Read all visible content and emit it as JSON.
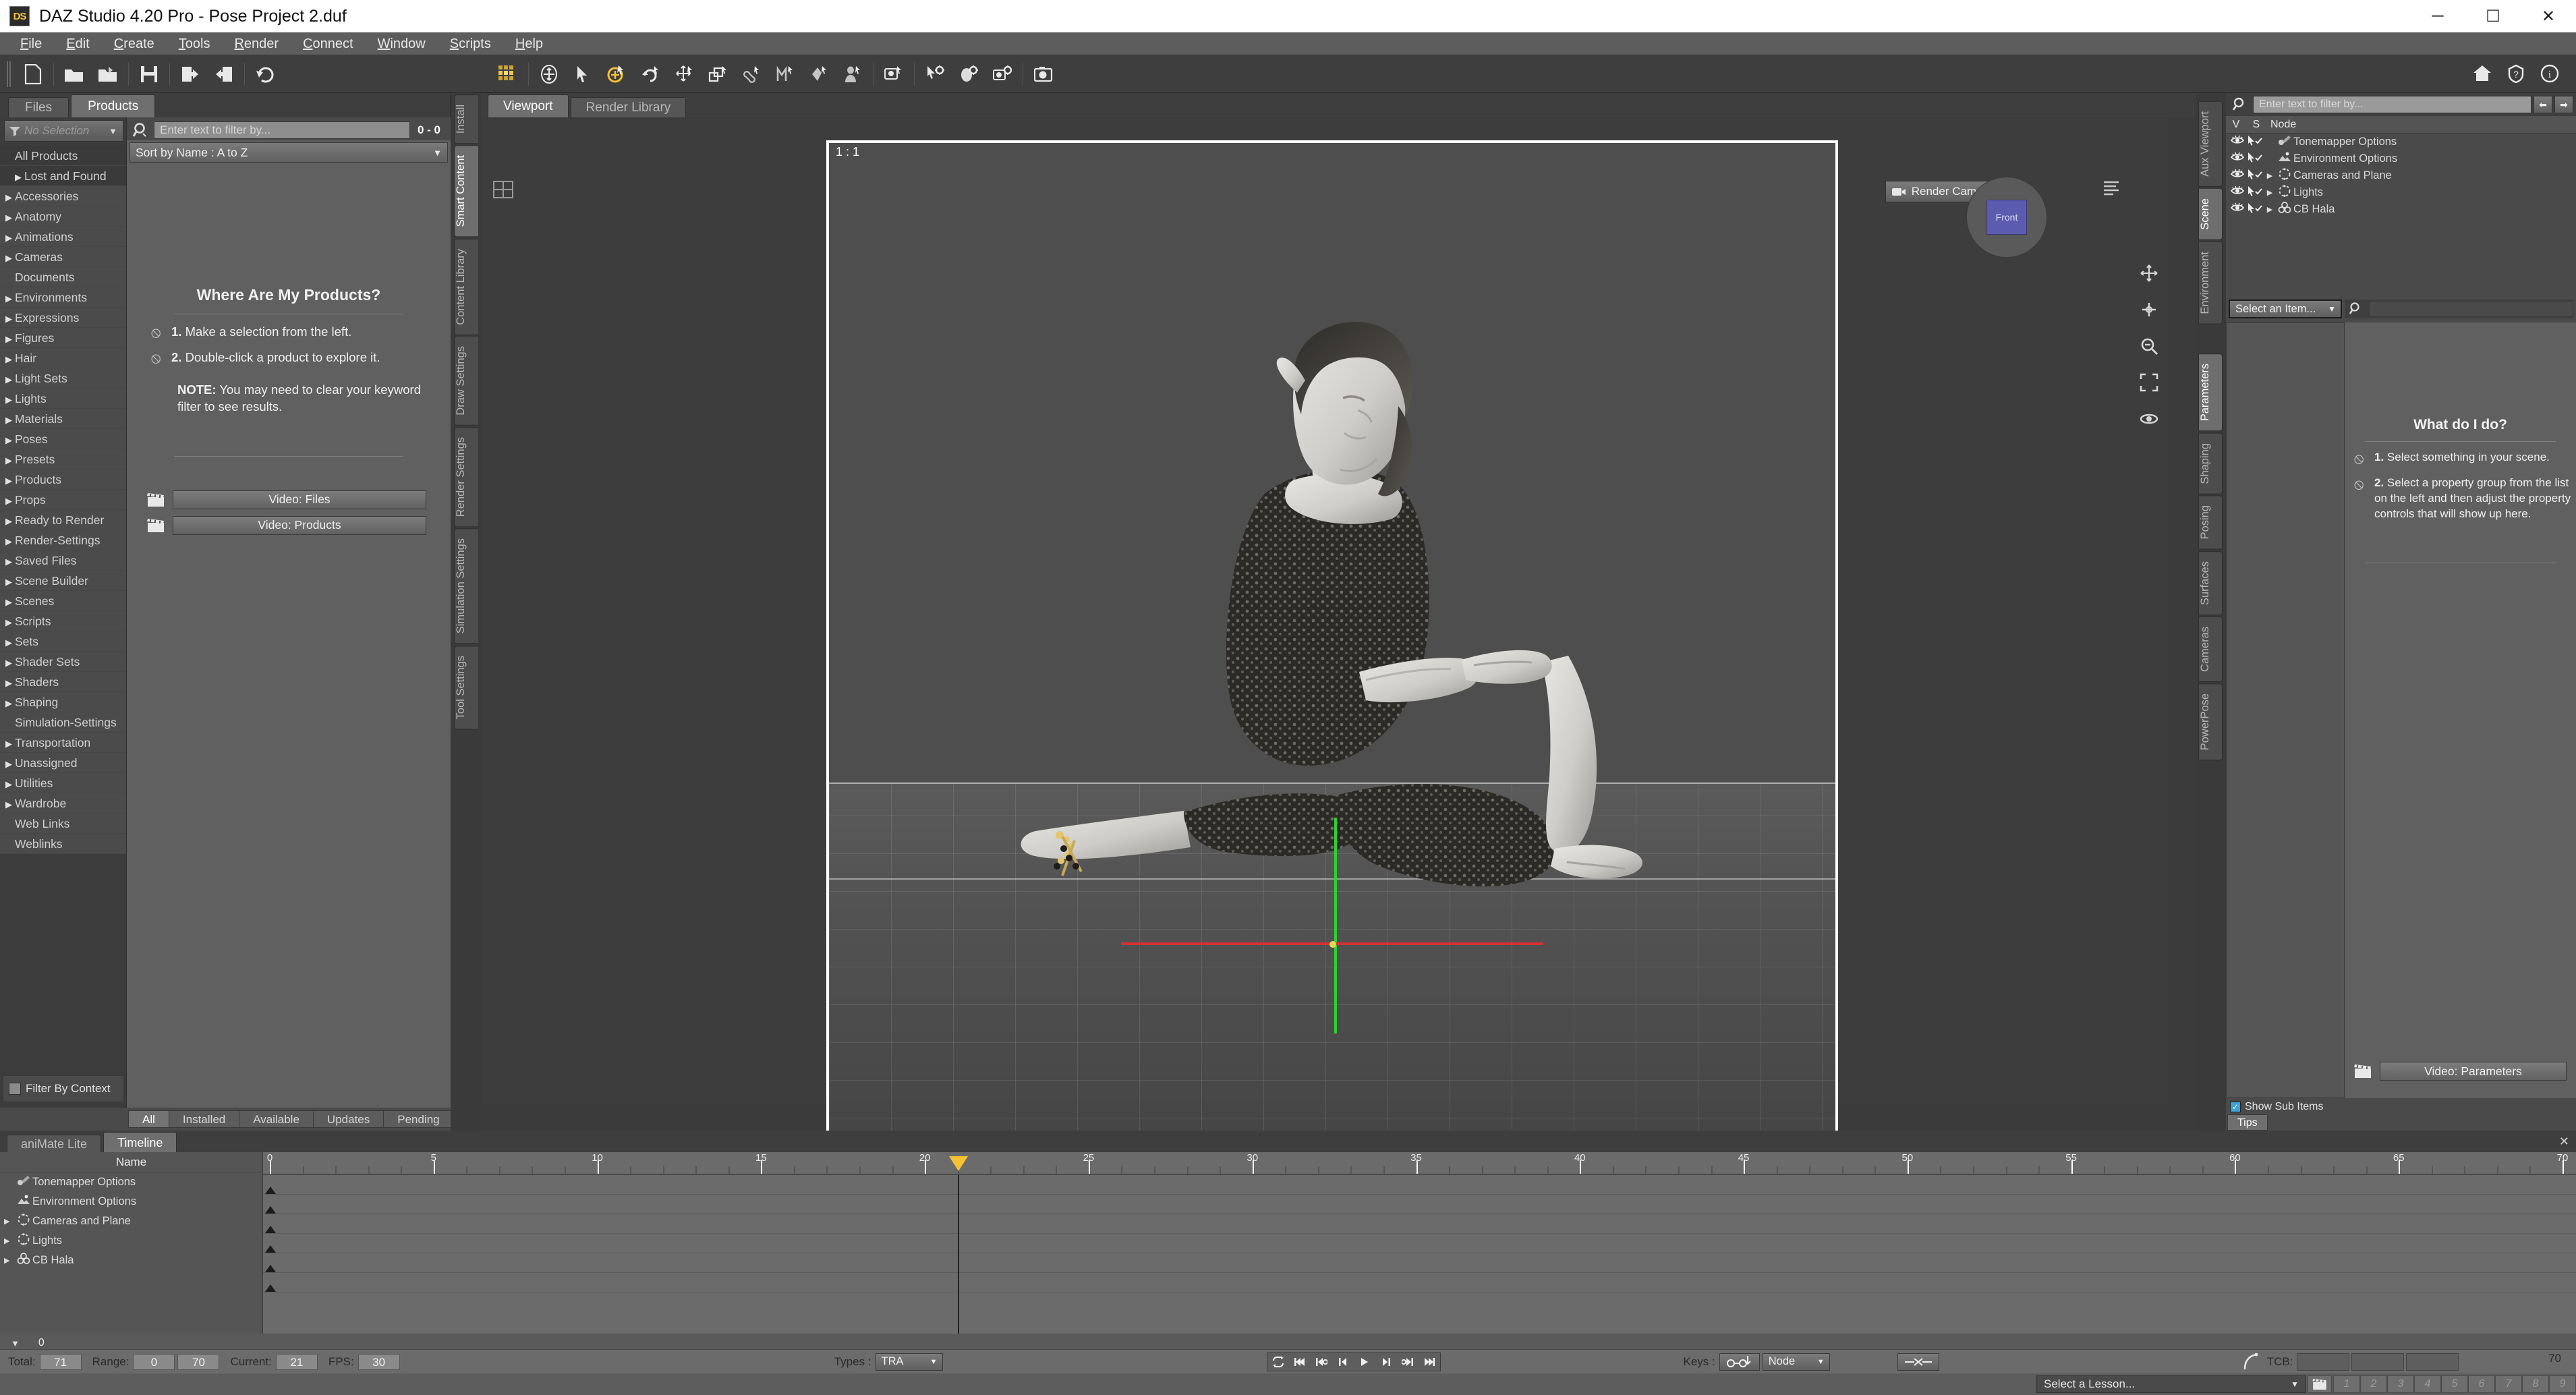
{
  "window": {
    "title": "DAZ Studio 4.20 Pro - Pose Project 2.duf",
    "logo": "DS",
    "minimize": "─",
    "maximize": "☐",
    "close": "✕"
  },
  "menu": [
    "File",
    "Edit",
    "Create",
    "Tools",
    "Render",
    "Connect",
    "Window",
    "Scripts",
    "Help"
  ],
  "toolbar": {
    "left_icons": [
      "new-document-icon",
      "open-folder-icon",
      "open-recent-icon",
      "save-icon",
      "import-icon",
      "export-icon",
      "undo-icon"
    ],
    "center_icons": [
      "texture-shaded-icon",
      "universal-manipulator-icon",
      "node-select-icon",
      "active-pose-icon",
      "rotate-icon",
      "translate-icon",
      "scale-icon",
      "bone-edit-icon",
      "morph-tool-icon",
      "mesh-grabber-icon",
      "surface-select-icon",
      "spot-render-icon",
      "node-pose-icon",
      "render-settings-icon",
      "camera-settings-icon",
      "render-icon"
    ],
    "right_icons": [
      "home-icon",
      "help-question-icon",
      "info-icon"
    ]
  },
  "left_panel": {
    "tabs": [
      {
        "label": "Files",
        "active": false
      },
      {
        "label": "Products",
        "active": true
      }
    ],
    "selection_dropdown": "No Selection",
    "categories": [
      {
        "label": "All Products",
        "expandable": false,
        "highlight": true
      },
      {
        "label": "Lost and Found",
        "expandable": true,
        "highlight": true
      },
      {
        "label": "Accessories",
        "expandable": true
      },
      {
        "label": "Anatomy",
        "expandable": true
      },
      {
        "label": "Animations",
        "expandable": true
      },
      {
        "label": "Cameras",
        "expandable": true
      },
      {
        "label": "Documents",
        "expandable": false
      },
      {
        "label": "Environments",
        "expandable": true
      },
      {
        "label": "Expressions",
        "expandable": true
      },
      {
        "label": "Figures",
        "expandable": true
      },
      {
        "label": "Hair",
        "expandable": true
      },
      {
        "label": "Light Sets",
        "expandable": true
      },
      {
        "label": "Lights",
        "expandable": true
      },
      {
        "label": "Materials",
        "expandable": true
      },
      {
        "label": "Poses",
        "expandable": true
      },
      {
        "label": "Presets",
        "expandable": true
      },
      {
        "label": "Products",
        "expandable": true
      },
      {
        "label": "Props",
        "expandable": true
      },
      {
        "label": "Ready to Render",
        "expandable": true
      },
      {
        "label": "Render-Settings",
        "expandable": true
      },
      {
        "label": "Saved Files",
        "expandable": true
      },
      {
        "label": "Scene Builder",
        "expandable": true
      },
      {
        "label": "Scenes",
        "expandable": true
      },
      {
        "label": "Scripts",
        "expandable": true
      },
      {
        "label": "Sets",
        "expandable": true
      },
      {
        "label": "Shader Sets",
        "expandable": true
      },
      {
        "label": "Shaders",
        "expandable": true
      },
      {
        "label": "Shaping",
        "expandable": true
      },
      {
        "label": "Simulation-Settings",
        "expandable": false
      },
      {
        "label": "Transportation",
        "expandable": true
      },
      {
        "label": "Unassigned",
        "expandable": true
      },
      {
        "label": "Utilities",
        "expandable": true
      },
      {
        "label": "Wardrobe",
        "expandable": true
      },
      {
        "label": "Web Links",
        "expandable": false
      },
      {
        "label": "Weblinks",
        "expandable": false
      }
    ],
    "filter_by_context": "Filter By Context",
    "search_placeholder": "Enter text to filter by...",
    "result_count": "0 - 0",
    "sort": "Sort by Name : A to Z",
    "help": {
      "title": "Where Are My Products?",
      "step1_num": "1.",
      "step1": "Make a selection from the left.",
      "step2_num": "2.",
      "step2": "Double-click a product to explore it.",
      "note_label": "NOTE:",
      "note": "You may need to clear your keyword filter to see results.",
      "video_files": "Video: Files",
      "video_products": "Video: Products"
    },
    "install_tabs": [
      {
        "label": "All",
        "active": true
      },
      {
        "label": "Installed",
        "active": false
      },
      {
        "label": "Available",
        "active": false
      },
      {
        "label": "Updates",
        "active": false
      },
      {
        "label": "Pending",
        "active": false
      }
    ],
    "vtabs": [
      {
        "label": "Install",
        "active": false
      },
      {
        "label": "Smart Content",
        "active": true
      },
      {
        "label": "Content Library",
        "active": false
      },
      {
        "label": "Draw Settings",
        "active": false
      },
      {
        "label": "Render Settings",
        "active": false
      },
      {
        "label": "Simulation Settings",
        "active": false
      },
      {
        "label": "Tool Settings",
        "active": false
      }
    ]
  },
  "viewport": {
    "tabs": [
      {
        "label": "Viewport",
        "active": true
      },
      {
        "label": "Render Library",
        "active": false
      }
    ],
    "aspect_ratio": "1 : 1",
    "camera": "Render Cam",
    "nav_cube_label": "Front",
    "right_tools": [
      "pan-icon",
      "move-icon",
      "zoom-icon",
      "frame-icon",
      "orbit-icon"
    ]
  },
  "right_panel": {
    "vtabs_top": [
      {
        "label": "Aux Viewport",
        "active": false
      },
      {
        "label": "Scene",
        "active": true
      },
      {
        "label": "Environment",
        "active": false
      }
    ],
    "vtabs_bottom": [
      {
        "label": "Parameters",
        "active": true
      },
      {
        "label": "Shaping",
        "active": false
      },
      {
        "label": "Posing",
        "active": false
      },
      {
        "label": "Surfaces",
        "active": false
      },
      {
        "label": "Cameras",
        "active": false
      },
      {
        "label": "PowerPose",
        "active": false
      }
    ],
    "search_placeholder": "Enter text to filter by...",
    "node_headers": [
      "V",
      "S",
      "Node"
    ],
    "nodes": [
      {
        "label": "Tonemapper Options",
        "icon": "tonemapper-icon",
        "expandable": false
      },
      {
        "label": "Environment Options",
        "icon": "environment-icon",
        "expandable": false
      },
      {
        "label": "Cameras and Plane",
        "icon": "group-icon",
        "expandable": true
      },
      {
        "label": "Lights",
        "icon": "group-icon",
        "expandable": true
      },
      {
        "label": "CB Hala",
        "icon": "figure-icon",
        "expandable": true
      }
    ],
    "select_item": "Select an Item...",
    "help": {
      "title": "What do I do?",
      "step1_num": "1.",
      "step1": "Select something in your scene.",
      "step2_num": "2.",
      "step2": "Select a property group from the list on the left and then adjust the property controls that will show up here.",
      "video_parameters": "Video: Parameters"
    },
    "show_sub_items": "Show Sub Items",
    "tips_tab": "Tips"
  },
  "timeline": {
    "tabs": [
      {
        "label": "aniMate Lite",
        "active": false
      },
      {
        "label": "Timeline",
        "active": true
      }
    ],
    "close": "✕",
    "name_header": "Name",
    "rows": [
      {
        "label": "Tonemapper Options",
        "icon": "tonemapper-icon",
        "expandable": false
      },
      {
        "label": "Environment Options",
        "icon": "environment-icon",
        "expandable": false
      },
      {
        "label": "Cameras and Plane",
        "icon": "group-icon",
        "expandable": true
      },
      {
        "label": "Lights",
        "icon": "group-icon",
        "expandable": true
      },
      {
        "label": "CB Hala",
        "icon": "figure-icon",
        "expandable": true
      }
    ],
    "ruler_labels": [
      "0",
      "5",
      "10",
      "15",
      "20",
      "25",
      "30",
      "35",
      "40",
      "45",
      "50",
      "55",
      "60",
      "65",
      "70"
    ],
    "ruler_min": 0,
    "ruler_max": 70,
    "playhead_frame": 21,
    "zoom_value": "0"
  },
  "status": {
    "total_label": "Total:",
    "total_value": "71",
    "range_label": "Range:",
    "range_start": "0",
    "range_end": "70",
    "current_label": "Current:",
    "current_value": "21",
    "fps_label": "FPS:",
    "fps_value": "30",
    "types_label": "Types :",
    "types_value": "TRA",
    "keys_label": "Keys :",
    "keys_value": "Node",
    "tcb_label": "TCB:",
    "transport_icons": [
      "loop-icon",
      "first-frame-icon",
      "prev-key-icon",
      "prev-frame-icon",
      "play-icon",
      "next-frame-icon",
      "next-key-icon",
      "last-frame-icon"
    ],
    "right_value": "70"
  },
  "lesson_bar": {
    "select": "Select a Lesson...",
    "numbers": [
      "1",
      "2",
      "3",
      "4",
      "5",
      "6",
      "7",
      "8",
      "9"
    ],
    "clap_icon": "clapperboard-icon"
  },
  "colors": {
    "accent_yellow": "#f5c234",
    "axis_green": "#30d030",
    "axis_red": "#cf3333",
    "titlebar_bg": "#ffffff",
    "panel_bg": "#4a4a4a"
  }
}
